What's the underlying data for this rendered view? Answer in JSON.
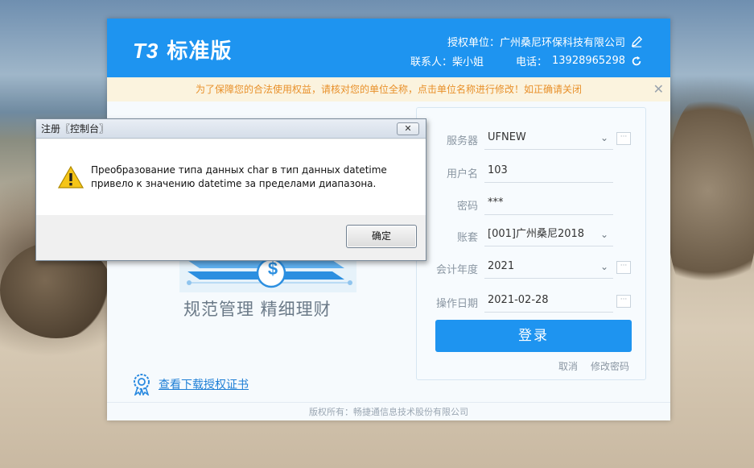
{
  "app": {
    "brand_t3": "T3",
    "brand_name": "标准版",
    "unit_label": "授权单位：广州桑尼环保科技有限公司",
    "contact_label": "联系人：柴小姐",
    "phone_label": "电话：",
    "phone": "13928965298"
  },
  "notice": {
    "text": "为了保障您的合法使用权益，请核对您的单位全称，点击单位名称进行修改！如正确请关闭",
    "close": "✕"
  },
  "hero": {
    "slogan": "规范管理  精细理财",
    "cert_link": "查看下载授权证书",
    "dollar": "$"
  },
  "login": {
    "server_label": "服务器",
    "server_value": "UFNEW",
    "user_label": "用户名",
    "user_value": "103",
    "password_label": "密码",
    "password_value": "***",
    "account_label": "账套",
    "account_value": "[001]广州桑尼2018",
    "year_label": "会计年度",
    "year_value": "2021",
    "date_label": "操作日期",
    "date_value": "2021-02-28",
    "more": "···",
    "login_button": "登录",
    "cancel": "取消",
    "change_password": "修改密码"
  },
  "footer": {
    "copyright": "版权所有：畅捷通信息技术股份有限公司"
  },
  "dialog": {
    "title": "注册〖控制台〗",
    "close": "✕",
    "message": "Преобразование типа данных char в тип данных datetime привело к значению datetime за пределами диапазона.",
    "ok": "确定"
  },
  "colors": {
    "primary": "#1e94f0",
    "notice_bg": "#fbf3de",
    "notice_text": "#e8902a"
  }
}
